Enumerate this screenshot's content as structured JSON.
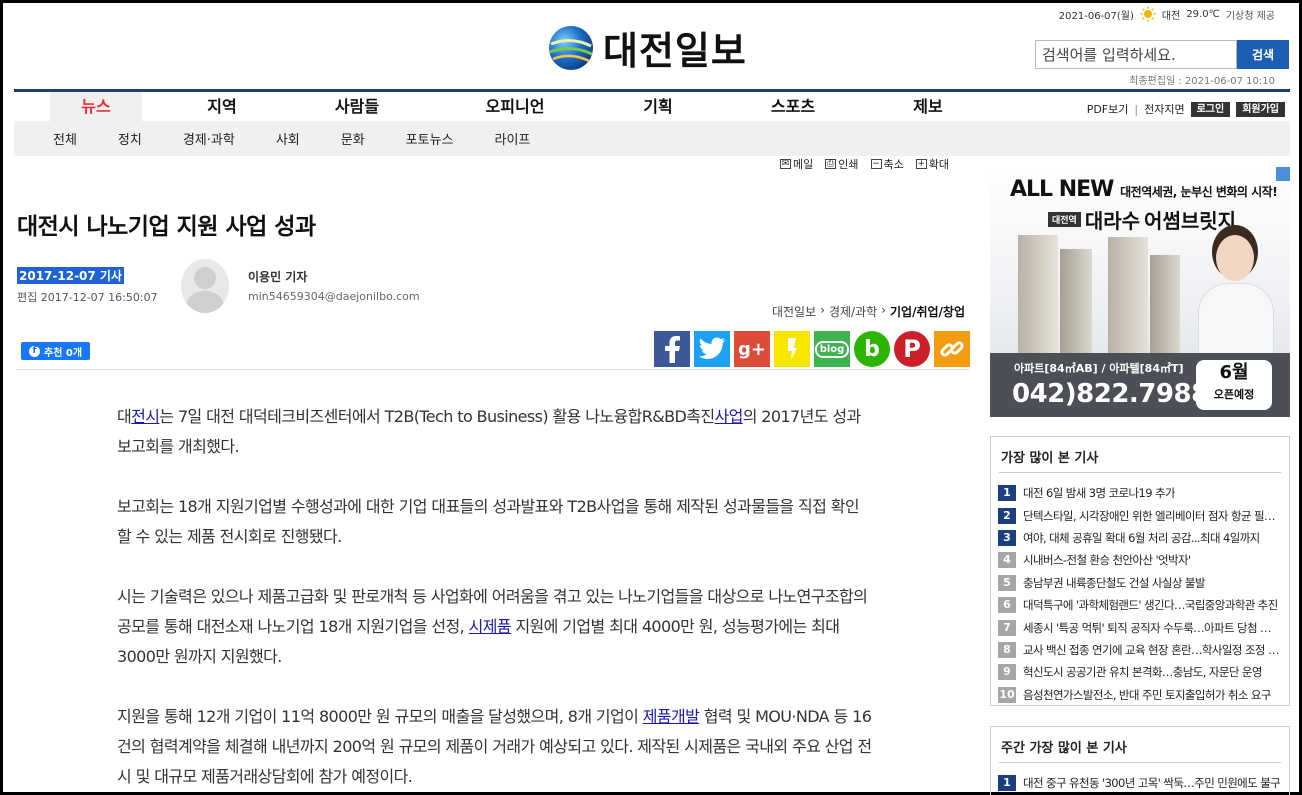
{
  "header": {
    "date": "2021-06-07(월)",
    "weather_city": "대전",
    "weather_temp": "29.0℃",
    "weather_source": "기상청 제공",
    "logo_text": "대전일보",
    "search_placeholder": "검색어를 입력하세요.",
    "search_button": "검색",
    "last_edit": "최종편집일 : 2021-06-07 10:10"
  },
  "nav": {
    "main": [
      "뉴스",
      "지역",
      "사람들",
      "오피니언",
      "기획",
      "스포츠",
      "제보"
    ],
    "sub": [
      "전체",
      "정치",
      "경제·과학",
      "사회",
      "문화",
      "포토뉴스",
      "라이프"
    ],
    "pdf": "PDF보기",
    "digital": "전자지면",
    "login": "로그인",
    "join": "회원가입"
  },
  "tools": {
    "mail": "메일",
    "print": "인쇄",
    "shrink": "축소",
    "enlarge": "확대"
  },
  "article": {
    "title": "대전시 나노기업 지원 사업 성과",
    "date": "2017-12-07 기사",
    "edited": "편집 2017-12-07 16:50:07",
    "reporter": "이용민 기자",
    "email": "min54659304@daejonilbo.com",
    "breadcrumb": [
      "대전일보",
      "경제/과학",
      "기업/취업/창업"
    ],
    "fb_like": "추천 0개",
    "p1_a": "대",
    "p1_link1": "전시",
    "p1_b": "는 7일 대전 대덕테크비즈센터에서 T2B(Tech to Business) 활용 나노융합R&BD촉진",
    "p1_link2": "사업",
    "p1_c": "의 2017년도 성과보고회를 개최했다.",
    "p2": "보고회는 18개 지원기업별 수행성과에 대한 기업 대표들의 성과발표와 T2B사업을 통해 제작된 성과물들을 직접 확인할 수 있는 제품 전시회로 진행됐다.",
    "p3_a": "시는 기술력은 있으나 제품고급화 및 판로개척 등 사업화에 어려움을 겪고 있는 나노기업들을 대상으로 나노연구조합의 공모를 통해 대전소재 나노기업 18개 지원기업을 선정, ",
    "p3_link": "시제품",
    "p3_b": " 지원에 기업별 최대 4000만 원, 성능평가에는 최대 3000만 원까지 지원했다.",
    "p4_a": "지원을 통해 12개 기업이 11억 8000만 원 규모의 매출을 달성했으며, 8개 기업이 ",
    "p4_link": "제품개발",
    "p4_b": " 협력 및 MOU·NDA 등 16건의 협력계약을 체결해 내년까지 200억 원 규모의 제품이 거래가 예상되고 있다. 제작된 시제품은 국내외 주요 산업 전시 및 대규모 제품거래상담회에 참가 예정이다."
  },
  "ad": {
    "headline": "ALL NEW",
    "headline_sub": "대전역세권, 눈부신 변화의 시작!",
    "tag": "대전역",
    "brand": "대라수",
    "brand_product": "어썸브릿지",
    "types": "아파트[84㎡AB] / 아파텔[84㎡T]",
    "phone": "042)822.7988",
    "open_month": "6월",
    "open_label": "오픈예정"
  },
  "most_viewed": {
    "title": "가장 많이 본 기사",
    "items": [
      "대전 6일 밤새 3명 코로나19 추가",
      "단텍스타일, 시각장애인 위한 엘리베이터 점자 항균 필름 기부",
      "여야, 대체 공휴일 확대 6월 처리 공감...최대 4일까지",
      "시내버스-전철 환승 천안아산 '엇박자'",
      "충남부권 내륙종단철도 건설 사실상 불발",
      "대덕특구에 '과학체험랜드' 생긴다…국립중앙과학관 추진",
      "세종시 '특공 먹튀' 퇴직 공직자 수두룩…아파트 당첨 후 떠나",
      "교사 백신 접종 연기에 교육 현장 혼란…학사일정 조정 불가피",
      "혁신도시 공공기관 유치 본격화…충남도, 자문단 운영",
      "음성천연가스발전소, 반대 주민 토지출입허가 취소 요구"
    ]
  },
  "weekly": {
    "title": "주간 가장 많이 본 기사",
    "items": [
      "대전 중구 유천동 '300년 고목' 싹둑…주민 민원에도 불구"
    ]
  }
}
